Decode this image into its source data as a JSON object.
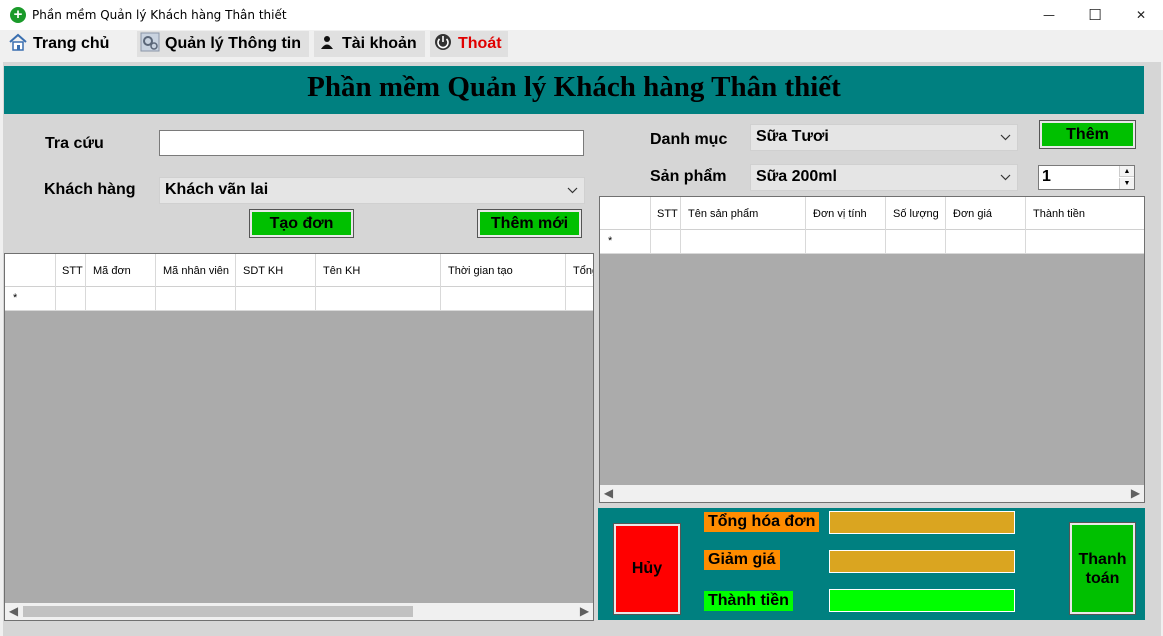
{
  "window": {
    "title": "Phần mềm Quản lý Khách hàng Thân thiết",
    "minimize_glyph": "—",
    "maximize_glyph": "☐",
    "close_glyph": "✕"
  },
  "menu": {
    "home": "Trang chủ",
    "manage": "Quản lý Thông tin",
    "account": "Tài khoản",
    "exit": "Thoát",
    "exit_color": "#e00000"
  },
  "banner": {
    "title": "Phần mềm Quản lý Khách hàng Thân thiết",
    "background": "#008080"
  },
  "order_form": {
    "search_label": "Tra cứu",
    "search_value": "",
    "customer_label": "Khách hàng",
    "customer_selected": "Khách vãn lai",
    "create_order_label": "Tạo đơn",
    "add_new_label": "Thêm mới"
  },
  "orders_grid": {
    "columns": [
      "STT",
      "Mã đơn",
      "Mã nhân viên",
      "SDT KH",
      "Tên KH",
      "Thời gian tạo",
      "Tổng"
    ],
    "new_row_marker": "*"
  },
  "product_form": {
    "category_label": "Danh mục",
    "category_selected": "Sữa Tươi",
    "add_label": "Thêm",
    "product_label": "Sản phẩm",
    "product_selected": "Sữa 200ml",
    "quantity": "1"
  },
  "items_grid": {
    "columns": [
      "STT",
      "Tên sản phẩm",
      "Đơn vị tính",
      "Số lượng",
      "Đơn giá",
      "Thành tiền"
    ],
    "new_row_marker": "*"
  },
  "checkout": {
    "cancel_label": "Hủy",
    "pay_label": "Thanh toán",
    "total_label": "Tổng hóa đơn",
    "discount_label": "Giảm giá",
    "final_label": "Thành tiền",
    "total_value": "",
    "discount_value": "",
    "final_value": "",
    "colors": {
      "panel": "#008080",
      "cancel": "#ff0000",
      "pay": "#00c000",
      "tag": "#ff8c00",
      "final_tag": "#00ff00",
      "field": "#daa520",
      "final_field": "#00ff00"
    }
  },
  "icons": {
    "app": "plus-circle-icon",
    "home": "house-icon",
    "manage": "gears-icon",
    "account": "user-icon",
    "exit": "power-icon",
    "scroll_left": "◀",
    "scroll_right": "▶",
    "combo_arrow": "⌄",
    "spin_up": "▲",
    "spin_down": "▼"
  }
}
